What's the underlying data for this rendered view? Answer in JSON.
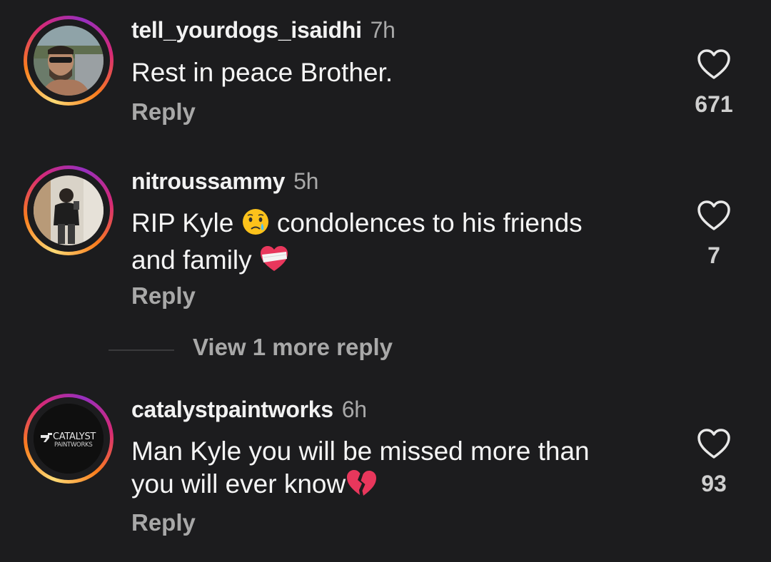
{
  "comments": [
    {
      "username": "tell_yourdogs_isaidhi",
      "time": "7h",
      "text": "Rest in peace Brother.",
      "reply_label": "Reply",
      "likes": "671"
    },
    {
      "username": "nitroussammy",
      "time": "5h",
      "text_part1": "RIP Kyle",
      "text_part2": "condolences to his friends",
      "text_part3": "and family",
      "emoji1": "crying-face",
      "emoji2": "mending-heart",
      "reply_label": "Reply",
      "likes": "7"
    },
    {
      "username": "catalystpaintworks",
      "time": "6h",
      "text_part1": "Man Kyle you will be missed more than",
      "text_part2": "you will ever know",
      "emoji1": "broken-heart",
      "reply_label": "Reply",
      "likes": "93",
      "avatar_logo_line1": "CATALYST",
      "avatar_logo_line2": "PAINTWORKS"
    }
  ],
  "view_more_replies": "View 1 more reply",
  "colors": {
    "background": "#1c1c1e",
    "muted": "#a8a8a8",
    "text": "#f5f5f5"
  }
}
